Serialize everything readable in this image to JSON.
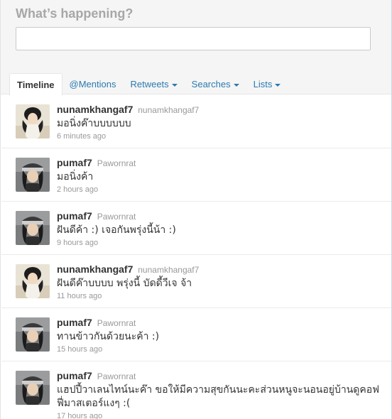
{
  "composer": {
    "title": "What’s happening?",
    "placeholder": ""
  },
  "tabs": [
    {
      "label": "Timeline",
      "active": true,
      "dropdown": false
    },
    {
      "label": "@Mentions",
      "active": false,
      "dropdown": false
    },
    {
      "label": "Retweets",
      "active": false,
      "dropdown": true
    },
    {
      "label": "Searches",
      "active": false,
      "dropdown": true
    },
    {
      "label": "Lists",
      "active": false,
      "dropdown": true
    }
  ],
  "tweets": [
    {
      "screen_name": "nunamkhangaf7",
      "full_name": "nunamkhangaf7",
      "text": "มอนิ่งค๊าบบบบบบ",
      "time": "6 minutes ago",
      "avatar": "avatar-girl-light"
    },
    {
      "screen_name": "pumaf7",
      "full_name": "Pawornrat",
      "text": "มอนิ่งค้า",
      "time": "2 hours ago",
      "avatar": "avatar-girl-cap"
    },
    {
      "screen_name": "pumaf7",
      "full_name": "Pawornrat",
      "text": "ฝันดีค้า :) เจอกันพรุ่งนี้น้า :)",
      "time": "9 hours ago",
      "avatar": "avatar-girl-cap"
    },
    {
      "screen_name": "nunamkhangaf7",
      "full_name": "nunamkhangaf7",
      "text": "ฝันดีค๊าบบบบ พรุ่งนี้ บัดดี้วีเจ จ้า",
      "time": "11 hours ago",
      "avatar": "avatar-girl-light"
    },
    {
      "screen_name": "pumaf7",
      "full_name": "Pawornrat",
      "text": "ทานข้าวกันด้วยนะค้า :)",
      "time": "15 hours ago",
      "avatar": "avatar-girl-cap"
    },
    {
      "screen_name": "pumaf7",
      "full_name": "Pawornrat",
      "text": "แฮปปี้วาเลนไทน์นะค๊า ขอให้มีความสุขกันนะคะส่วนหนูจะนอนอยู่บ้านดูคอฟฟี่มาสเตอร์แงๆ :(",
      "time": "17 hours ago",
      "avatar": "avatar-girl-cap"
    }
  ]
}
